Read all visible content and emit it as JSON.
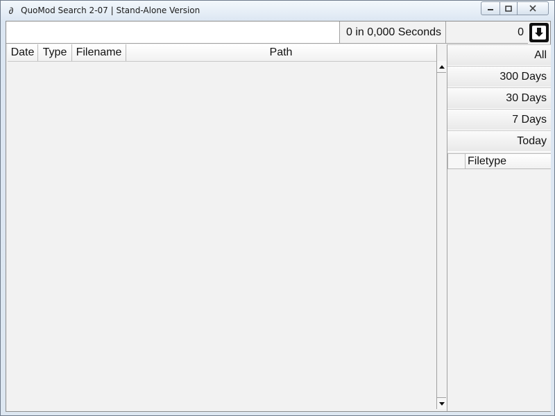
{
  "window": {
    "title": "QuoMod Search 2-07 | Stand-Alone Version",
    "app_icon": "∂"
  },
  "caption_buttons": {
    "minimize": "minimize-icon",
    "maximize": "maximize-icon",
    "close": "close-icon"
  },
  "search": {
    "value": "",
    "timing_text": "0 in 0,000 Seconds",
    "result_count": "0",
    "download_icon": "download-icon"
  },
  "results": {
    "columns": [
      "Date",
      "Type",
      "Filename",
      "Path"
    ],
    "rows": []
  },
  "filters": {
    "items": [
      "All",
      "300 Days",
      "30 Days",
      "7 Days",
      "Today"
    ],
    "filetype_header": "Filetype"
  },
  "colors": {
    "panel_bg": "#f2f2f2",
    "border": "#a0a0a0",
    "download_button": "#111111"
  }
}
